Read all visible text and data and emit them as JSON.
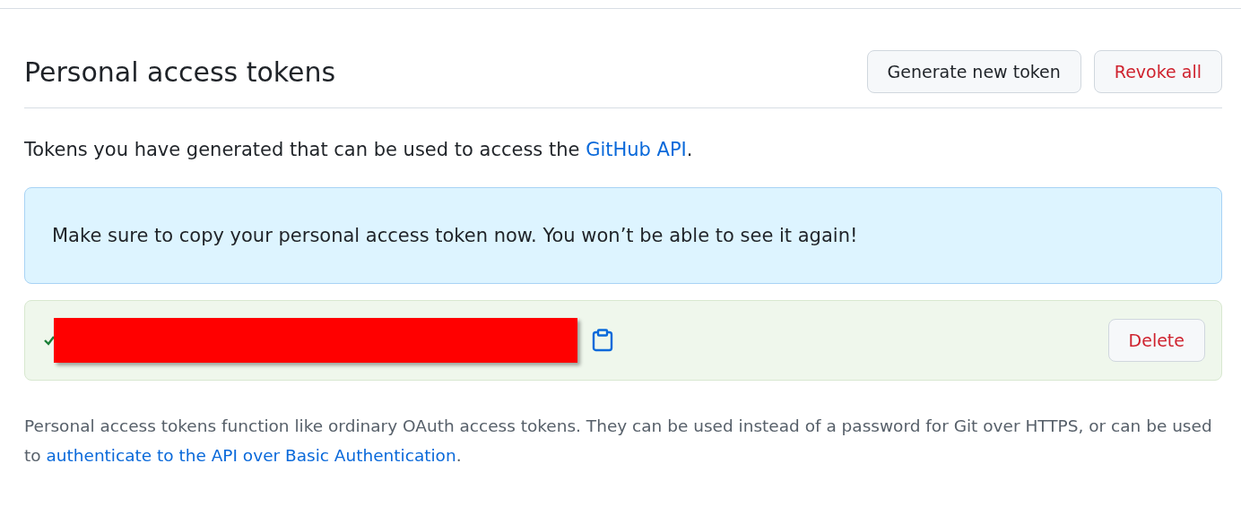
{
  "header": {
    "title": "Personal access tokens",
    "buttons": [
      {
        "label": "Generate new token",
        "kind": "default"
      },
      {
        "label": "Revoke all",
        "kind": "danger"
      }
    ]
  },
  "description": {
    "before": "Tokens you have generated that can be used to access the ",
    "link": "GitHub API",
    "after": "."
  },
  "flash": {
    "message": "Make sure to copy your personal access token now. You won’t be able to see it again!"
  },
  "token": {
    "delete_label": "Delete"
  },
  "footer": {
    "before": "Personal access tokens function like ordinary OAuth access tokens. They can be used instead of a password for Git over HTTPS, or can be used to ",
    "link": "authenticate to the API over Basic Authentication",
    "after": "."
  }
}
